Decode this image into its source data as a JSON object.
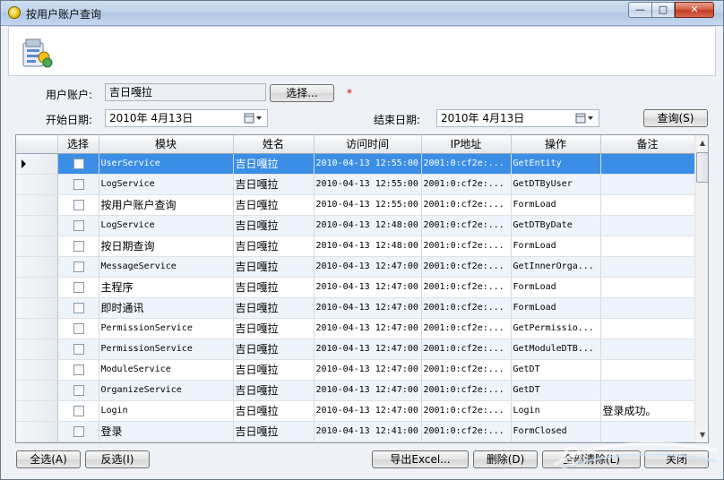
{
  "window": {
    "title": "按用户账户查询",
    "minimize_glyph": "—",
    "maximize_glyph": "□",
    "close_glyph": "✕"
  },
  "form": {
    "user_account_label": "用户账户:",
    "user_account_value": "吉日嘎拉",
    "select_button": "选择...",
    "required_mark": "*",
    "start_date_label": "开始日期:",
    "start_date_value": "2010年 4月13日",
    "end_date_label": "结束日期:",
    "end_date_value": "2010年 4月13日",
    "query_button": "查询(S)"
  },
  "grid": {
    "columns": [
      "选择",
      "模块",
      "姓名",
      "访问时间",
      "IP地址",
      "操作",
      "备注"
    ],
    "rows": [
      {
        "module": "UserService",
        "name": "吉日嘎拉",
        "time": "2010-04-13 12:55:00",
        "ip": "2001:0:cf2e:...",
        "op": "GetEntity",
        "note": ""
      },
      {
        "module": "LogService",
        "name": "吉日嘎拉",
        "time": "2010-04-13 12:55:00",
        "ip": "2001:0:cf2e:...",
        "op": "GetDTByUser",
        "note": ""
      },
      {
        "module": "按用户账户查询",
        "name": "吉日嘎拉",
        "time": "2010-04-13 12:55:00",
        "ip": "2001:0:cf2e:...",
        "op": "FormLoad",
        "note": ""
      },
      {
        "module": "LogService",
        "name": "吉日嘎拉",
        "time": "2010-04-13 12:48:00",
        "ip": "2001:0:cf2e:...",
        "op": "GetDTByDate",
        "note": ""
      },
      {
        "module": "按日期查询",
        "name": "吉日嘎拉",
        "time": "2010-04-13 12:48:00",
        "ip": "2001:0:cf2e:...",
        "op": "FormLoad",
        "note": ""
      },
      {
        "module": "MessageService",
        "name": "吉日嘎拉",
        "time": "2010-04-13 12:47:00",
        "ip": "2001:0:cf2e:...",
        "op": "GetInnerOrga...",
        "note": ""
      },
      {
        "module": "主程序",
        "name": "吉日嘎拉",
        "time": "2010-04-13 12:47:00",
        "ip": "2001:0:cf2e:...",
        "op": "FormLoad",
        "note": ""
      },
      {
        "module": "即时通讯",
        "name": "吉日嘎拉",
        "time": "2010-04-13 12:47:00",
        "ip": "2001:0:cf2e:...",
        "op": "FormLoad",
        "note": ""
      },
      {
        "module": "PermissionService",
        "name": "吉日嘎拉",
        "time": "2010-04-13 12:47:00",
        "ip": "2001:0:cf2e:...",
        "op": "GetPermissio...",
        "note": ""
      },
      {
        "module": "PermissionService",
        "name": "吉日嘎拉",
        "time": "2010-04-13 12:47:00",
        "ip": "2001:0:cf2e:...",
        "op": "GetModuleDTB...",
        "note": ""
      },
      {
        "module": "ModuleService",
        "name": "吉日嘎拉",
        "time": "2010-04-13 12:47:00",
        "ip": "2001:0:cf2e:...",
        "op": "GetDT",
        "note": ""
      },
      {
        "module": "OrganizeService",
        "name": "吉日嘎拉",
        "time": "2010-04-13 12:47:00",
        "ip": "2001:0:cf2e:...",
        "op": "GetDT",
        "note": ""
      },
      {
        "module": "Login",
        "name": "吉日嘎拉",
        "time": "2010-04-13 12:47:00",
        "ip": "2001:0:cf2e:...",
        "op": "Login",
        "note": "登录成功。"
      },
      {
        "module": "登录",
        "name": "吉日嘎拉",
        "time": "2010-04-13 12:41:00",
        "ip": "2001:0:cf2e:...",
        "op": "FormClosed",
        "note": ""
      }
    ]
  },
  "footer": {
    "select_all": "全选(A)",
    "invert": "反选(I)",
    "export": "导出Excel...",
    "delete": "删除(D)",
    "clear_all": "全部清除(L)",
    "close": "关闭"
  },
  "colors": {
    "selected_row": "#3a8ee6",
    "alt_row": "#eef4fb",
    "required": "#d00000"
  }
}
